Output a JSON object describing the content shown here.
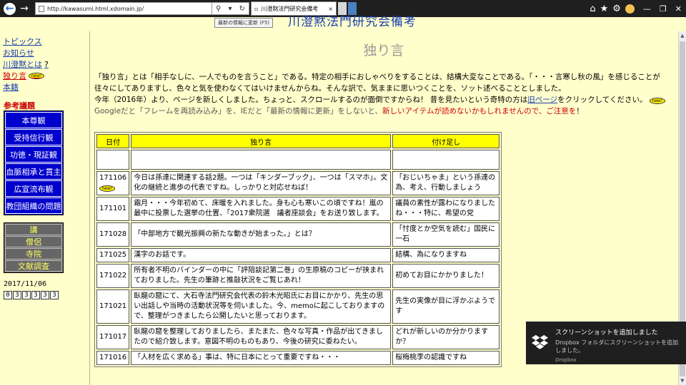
{
  "browser": {
    "url": "http://kawasumi.html.xdomain.jp/",
    "tab_title": "川澄黙法門研究会備考",
    "tooltip": "最新の情報に更新 (F5)"
  },
  "site_title": "川澄黙法門研究会備考",
  "sidebar": {
    "links": [
      {
        "label": "トピックス",
        "badge": ""
      },
      {
        "label": "お知らせ",
        "badge": ""
      },
      {
        "label": "川澄黙とは",
        "suffix": "?"
      },
      {
        "label": "独り言",
        "badge": "new!"
      },
      {
        "label": "本籍",
        "badge": ""
      }
    ],
    "section_label": "参考議題",
    "blue_menu": [
      "本尊観",
      "受持信行観",
      "功徳・現証観",
      "血脈相承と貫主",
      "広宣流布観",
      "教団組織の問題"
    ],
    "gray_menu": [
      "講",
      "僧侶",
      "寺院",
      "文献調査"
    ],
    "date": "2017/11/06",
    "counter": [
      "0",
      "3",
      "3",
      "3",
      "3",
      "3"
    ]
  },
  "main": {
    "heading": "独り言",
    "intro1": "「独り言」とは「相手なしに、一人でものを言うこと」である。特定の相手におしゃべりをすることは、結構大変なことである。「・・・言寒し秋の風」を感じることが往々にしてありますし、色々と気を使わなくてはいけませんからね。そんな訳で、気ままに思いつくことを、ソット述べることとしました。",
    "intro2_pre": "今年（2016年）より、ページを新しくしました。ちょっと、スクロールするのが面倒ですからね！ 昔を見たいという奇特の方は",
    "intro2_link": "旧ページ",
    "intro2_post": "をクリックしてください。",
    "intro2_badge": "new!",
    "intro3_pre": "Googleだと「フレームを再読み込み」を、IEだと「最新の情報に更新」をしないと、",
    "intro3_red": "新しいアイテムが読めないかもしれませんので、ご注意を",
    "intro3_post": "！",
    "table": {
      "headers": [
        "日付",
        "独り言",
        "付け足し"
      ],
      "rows": [
        {
          "date": "",
          "text": "",
          "note": ""
        },
        {
          "date": "171106",
          "badge": "new!",
          "text": "今日は孫達に関連する話2題。一つは「キンダーブック」、一つは「スマホ」。文化の継続と進歩の代表ですね。しっかりと対応せねば！",
          "note": "「おじいちゃま」という孫達の為、考え、行動しましょう"
        },
        {
          "date": "171101",
          "text": "霜月・・・今年初めて、床暖を入れました。身も心も寒いこの頃ですね！嵐の最中に投票した選挙の仕置、「2017衆院選　議者座談会」をお送り致します。",
          "note": "議員の素性が露わになりましたね・・・特に、希望の党"
        },
        {
          "date": "171028",
          "text": "「中部地方で観光振興の新たな動きが始まった。」とは？",
          "note": "「忖度とか空気を読む」国民に一石"
        },
        {
          "date": "171025",
          "text": "漢字のお話です。",
          "note": "結構、為になりますね"
        },
        {
          "date": "171022",
          "text": "所有者不明のバインダーの中に「評陪談記第二巻」の生原稿のコピーが挟まれておりました。先生の筆跡と推敲状況をご覧じあれ！",
          "note": "初めてお目にかかりました！"
        },
        {
          "date": "171021",
          "text": "臥龍の窟にて、大石寺法門研究会代表の鈴木光昭氏にお目にかかり、先生の思い出話しや当時の活動状況等を伺いました。今、memoに起こしておりますので、整理がつきましたら公開したいと思っております。",
          "note": "先生の実像が目に浮かぶようです"
        },
        {
          "date": "171017",
          "text": "臥龍の窟を整理しておりましたら、またまた、色々な写真・作品が出てきましたので紹介致します。意図不明のものもあり、今後の研究に委ねたい。",
          "note": "どれが新しいのか分かりますか？"
        },
        {
          "date": "171016",
          "text": "「人材を広く求める」事は、特に日本にとって重要ですね・・・",
          "note": "桜梅桃李の認識ですね"
        }
      ]
    }
  },
  "toast": {
    "title": "スクリーンショットを追加しました",
    "body": "Dropbox フォルダにスクリーンショットを追加しました。",
    "source": "Dropbox"
  },
  "colors": {
    "page_bg": "#ffffcc",
    "menu_blue": "#0000cc",
    "header_yellow": "#ffff00",
    "accent_red": "#cc0000"
  }
}
